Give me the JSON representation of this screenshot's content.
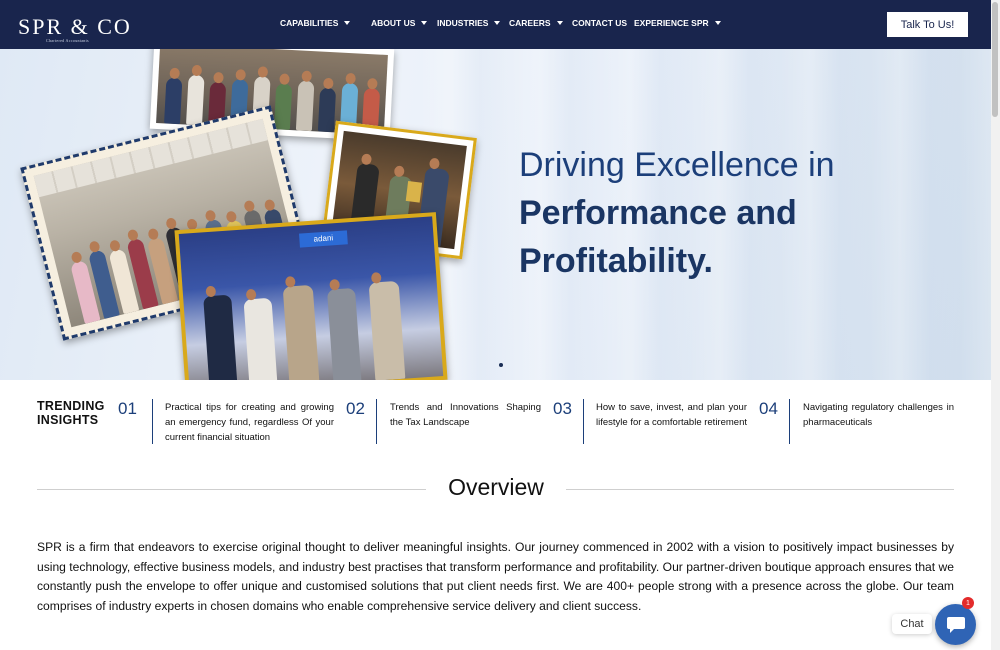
{
  "brand": {
    "name": "SPR & CO",
    "tagline": "Chartered Accountants"
  },
  "nav": {
    "items": [
      {
        "label": "CAPABILITIES",
        "dropdown": true
      },
      {
        "label": "ABOUT US",
        "dropdown": true
      },
      {
        "label": "INDUSTRIES",
        "dropdown": true
      },
      {
        "label": "CAREERS",
        "dropdown": true
      },
      {
        "label": "CONTACT US",
        "dropdown": false
      },
      {
        "label": "EXPERIENCE SPR",
        "dropdown": true
      }
    ],
    "cta_label": "Talk To Us!"
  },
  "hero": {
    "line1": "Driving Excellence in",
    "line2": "Performance and",
    "line3": "Profitability."
  },
  "trending": {
    "label_line1": "TRENDING",
    "label_line2": "INSIGHTS",
    "items": [
      {
        "num": "01",
        "text": "Practical tips for creating and growing an emergency fund, regardless Of your current financial situation"
      },
      {
        "num": "02",
        "text": "Trends and Innovations Shaping the Tax Landscape"
      },
      {
        "num": "03",
        "text": "How to save, invest, and plan your lifestyle for a comfortable retirement"
      },
      {
        "num": "04",
        "text": "Navigating regulatory challenges in pharmaceuticals"
      }
    ]
  },
  "overview": {
    "title": "Overview",
    "body": "SPR is a firm that endeavors to exercise original thought to deliver meaningful insights. Our journey commenced in 2002 with a vision to positively impact businesses by using technology, effective business models, and industry best practises that transform performance and profitability. Our partner-driven boutique approach ensures that we constantly push the envelope to offer unique and customised solutions that put client needs first. We are 400+ people strong with a presence across the globe. Our team comprises of industry experts in chosen domains who enable comprehensive service delivery and client success."
  },
  "chat": {
    "label": "Chat",
    "badge": "1"
  },
  "colors": {
    "navy": "#19254d",
    "accent_blue": "#1c3f7a",
    "chat_blue": "#2f64b5",
    "badge_red": "#e32b2b"
  },
  "icons": {
    "dropdown": "caret-down-icon",
    "chat": "chat-bubble-icon"
  }
}
